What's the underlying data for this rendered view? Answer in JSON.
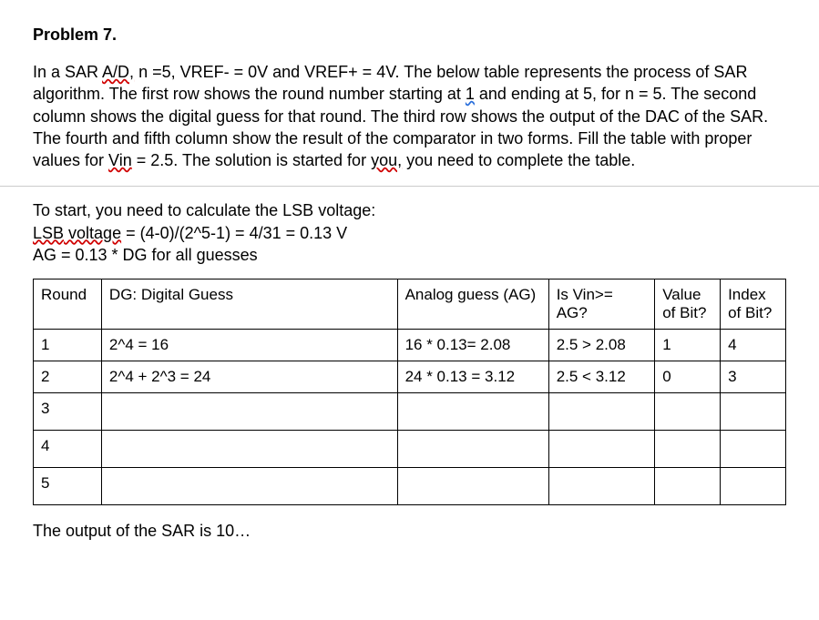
{
  "title": "Problem 7.",
  "para": {
    "pre": "In a SAR ",
    "sar_ad": "A/D,",
    "after_ad": " n =5, VREF- = 0V and VREF+ = 4V. The below table represents the process of SAR algorithm. The first row shows the round number starting at ",
    "one": "1",
    "after_one": " and ending at 5, for n = 5. The second column shows the digital guess for that round. The third row shows the output of the DAC of the SAR. The fourth and fifth column show the result of the comparator in two forms. Fill the table with proper values for ",
    "vin": "Vin",
    "after_vin": " = 2.5. The solution is started for ",
    "you": "you,",
    "after_you": " you need to complete the table."
  },
  "calc": {
    "l1": "To start, you need to calculate the LSB voltage:",
    "l2a": "LSB",
    "l2a2": " voltage",
    "l2b": " = (4-0)/(2^5-1) = 4/31 = 0.13 V",
    "l3": "AG = 0.13 * DG for all guesses"
  },
  "headers": {
    "round": "Round",
    "dg": "DG: Digital Guess",
    "ag": "Analog guess (AG)",
    "comp": "Is Vin>= AG?",
    "val": "Value of Bit?",
    "idx": "Index of Bit?"
  },
  "rows": [
    {
      "round": "1",
      "dg": "2^4 = 16",
      "ag": "16 * 0.13= 2.08",
      "comp": "2.5 > 2.08",
      "val": "1",
      "idx": "4"
    },
    {
      "round": "2",
      "dg": "2^4 + 2^3 = 24",
      "ag": "24 * 0.13 = 3.12",
      "comp": "2.5 < 3.12",
      "val": "0",
      "idx": "3"
    },
    {
      "round": "3",
      "dg": "",
      "ag": "",
      "comp": "",
      "val": "",
      "idx": ""
    },
    {
      "round": "4",
      "dg": "",
      "ag": "",
      "comp": "",
      "val": "",
      "idx": ""
    },
    {
      "round": "5",
      "dg": "",
      "ag": "",
      "comp": "",
      "val": "",
      "idx": ""
    }
  ],
  "output_line": "The output of the SAR is 10…"
}
